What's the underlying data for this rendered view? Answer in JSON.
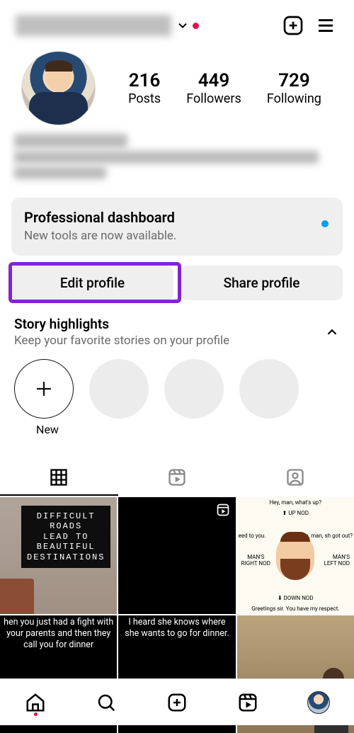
{
  "header": {
    "chevron_icon": "chevron-down"
  },
  "stats": {
    "posts_count": "216",
    "posts_label": "Posts",
    "followers_count": "449",
    "followers_label": "Followers",
    "following_count": "729",
    "following_label": "Following"
  },
  "dashboard": {
    "title": "Professional dashboard",
    "subtitle": "New tools are now available."
  },
  "buttons": {
    "edit": "Edit profile",
    "share": "Share profile"
  },
  "highlights": {
    "title": "Story highlights",
    "subtitle": "Keep your favorite stories on your profile",
    "new_label": "New"
  },
  "grid": {
    "cell1_text": "DIFFICULT\nROADS\nLEAD TO\nBEAUTIFUL\nDESTINATIONS",
    "cell3": {
      "top": "Hey, man, what's up?",
      "up": "UP NOD",
      "left": "MAN'S\nRIGHT NOD",
      "right": "MAN'S\nLEFT NOD",
      "leftnote": "eed to\nyou.",
      "rightnote": "Yo, man, sh\ngot out?",
      "down": "DOWN NOD",
      "bottom": "Greetings sir. You have my respect."
    },
    "cell4_text": "hen you just had a fight with your parents and then they call you for dinner",
    "cell5_text": "I heard she knows where she wants to go for dinner."
  }
}
